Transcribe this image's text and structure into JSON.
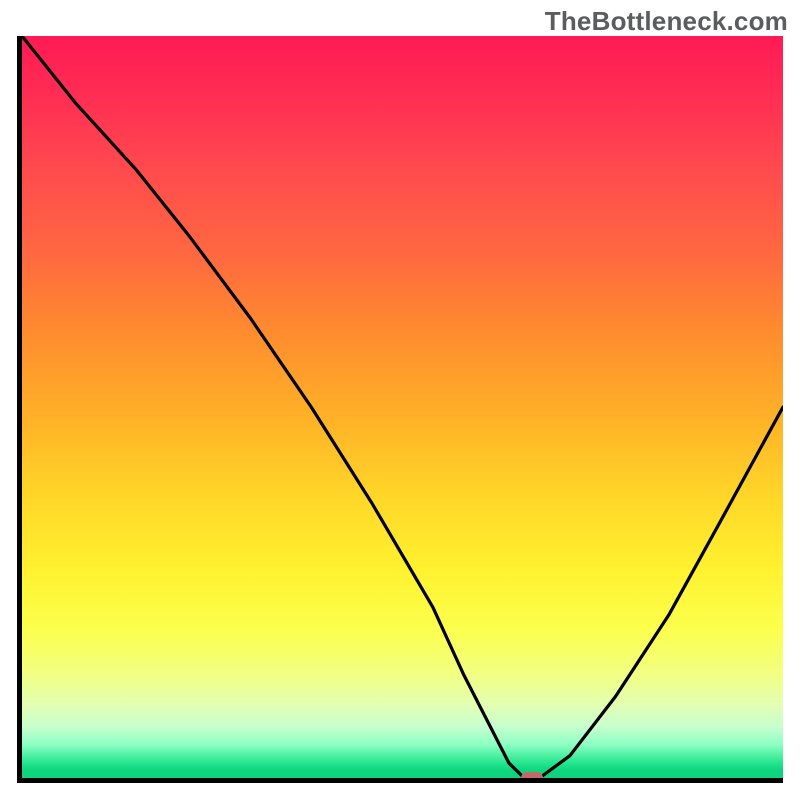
{
  "watermark": "TheBottleneck.com",
  "colors": {
    "gradient_top": "#ff1a55",
    "gradient_mid": "#ffd628",
    "gradient_bottom": "#0fd47e",
    "curve_stroke": "#000000",
    "marker_fill": "#c26969",
    "axis_stroke": "#000000"
  },
  "chart_data": {
    "type": "line",
    "title": "",
    "xlabel": "",
    "ylabel": "",
    "xlim": [
      0,
      100
    ],
    "ylim": [
      0,
      100
    ],
    "x": [
      0,
      7,
      15,
      22,
      30,
      38,
      46,
      54,
      58,
      62,
      64,
      66,
      68,
      72,
      78,
      85,
      92,
      100
    ],
    "values": [
      100,
      91,
      82,
      73,
      62,
      50,
      37,
      23,
      14,
      6,
      2,
      0,
      0,
      3,
      11,
      22,
      35,
      50
    ],
    "marker": {
      "x": 67,
      "y": 0
    },
    "annotations": []
  }
}
